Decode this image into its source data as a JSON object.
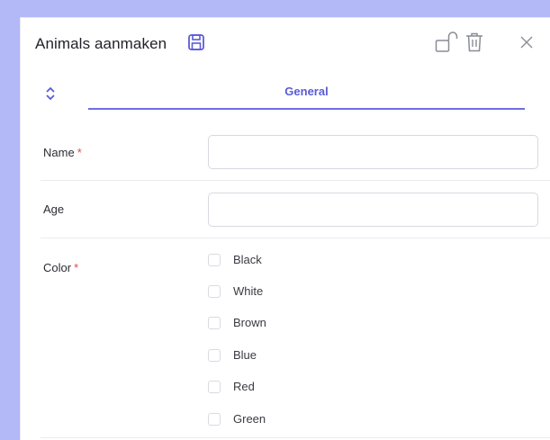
{
  "header": {
    "title": "Animals aanmaken",
    "icons": [
      "save-icon",
      "unlock-icon",
      "trash-icon",
      "close-icon"
    ]
  },
  "tabs": {
    "expand_icon": "chevron-up-down-icon",
    "active": "General"
  },
  "form": {
    "name": {
      "label": "Name",
      "required_mark": "*",
      "value": ""
    },
    "age": {
      "label": "Age",
      "value": ""
    },
    "color": {
      "label": "Color",
      "required_mark": "*",
      "options": [
        {
          "label": "Black",
          "checked": false
        },
        {
          "label": "White",
          "checked": false
        },
        {
          "label": "Brown",
          "checked": false
        },
        {
          "label": "Blue",
          "checked": false
        },
        {
          "label": "Red",
          "checked": false
        },
        {
          "label": "Green",
          "checked": false
        }
      ]
    }
  },
  "colors": {
    "background": "#b3b8f7",
    "accent": "#5a5bd5",
    "required": "#e5484d"
  }
}
